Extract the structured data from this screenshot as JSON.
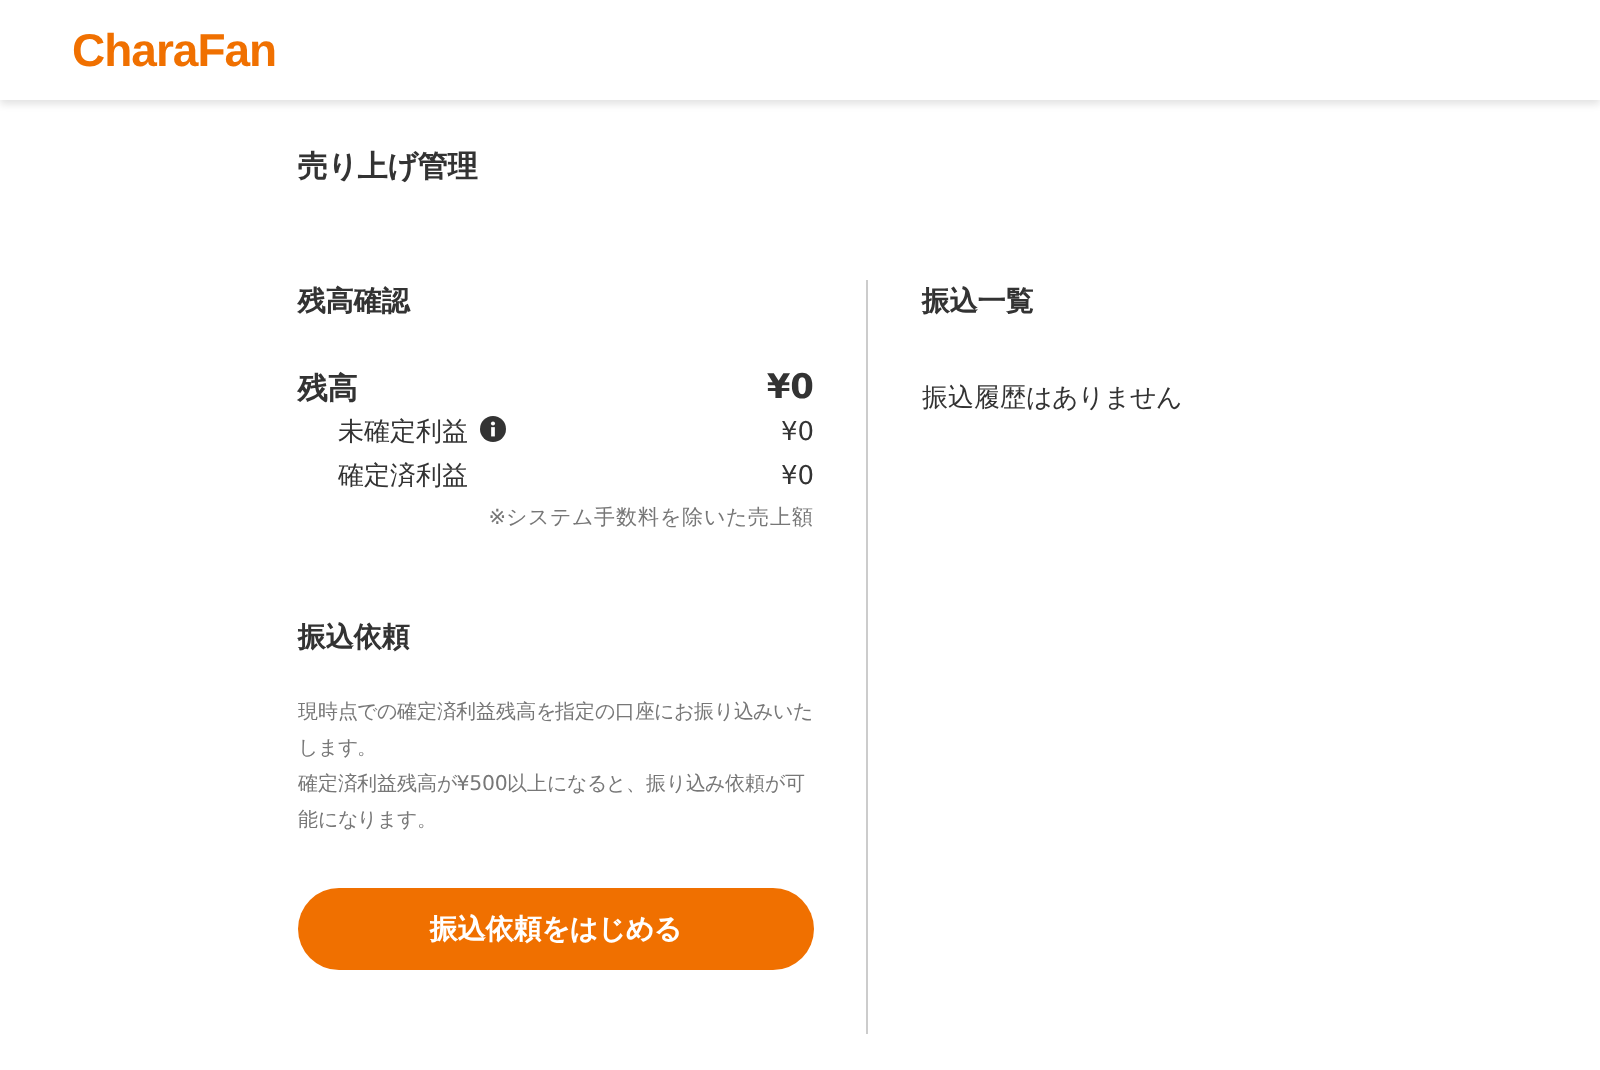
{
  "header": {
    "logo": "CharaFan"
  },
  "page_title": "売り上げ管理",
  "balance": {
    "heading": "残高確認",
    "total_label": "残高",
    "total_value": "¥0",
    "items": [
      {
        "label": "未確定利益",
        "info": true,
        "value": "¥0"
      },
      {
        "label": "確定済利益",
        "info": false,
        "value": "¥0"
      }
    ],
    "note": "※システム手数料を除いた売上額"
  },
  "transfer_request": {
    "heading": "振込依頼",
    "paragraphs": [
      "現時点での確定済利益残高を指定の口座にお振り込みいたします。",
      "確定済利益残高が¥500以上になると、振り込み依頼が可能になります。"
    ],
    "button": "振込依頼をはじめる"
  },
  "transfer_list": {
    "heading": "振込一覧",
    "empty": "振込履歴はありません"
  }
}
